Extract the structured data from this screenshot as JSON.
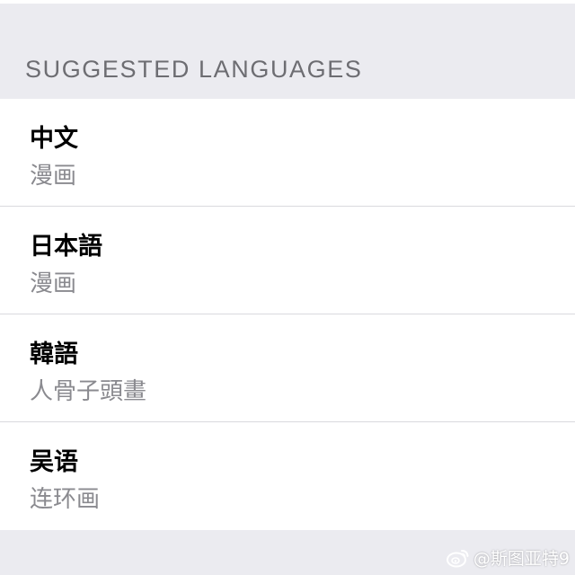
{
  "section": {
    "title": "SUGGESTED LANGUAGES"
  },
  "languages": [
    {
      "name": "中文",
      "sample": "漫画"
    },
    {
      "name": "日本語",
      "sample": "漫画"
    },
    {
      "name": "韓語",
      "sample": "人骨子頭畫"
    },
    {
      "name": "吴语",
      "sample": "连环画"
    }
  ],
  "watermark": {
    "icon": "weibo-icon",
    "text": "@斯图亚特9"
  },
  "colors": {
    "background": "#ebebf0",
    "header_text": "#6d6d72",
    "primary_text": "#000000",
    "secondary_text": "#8a8a8f",
    "separator": "#d9d9de"
  }
}
